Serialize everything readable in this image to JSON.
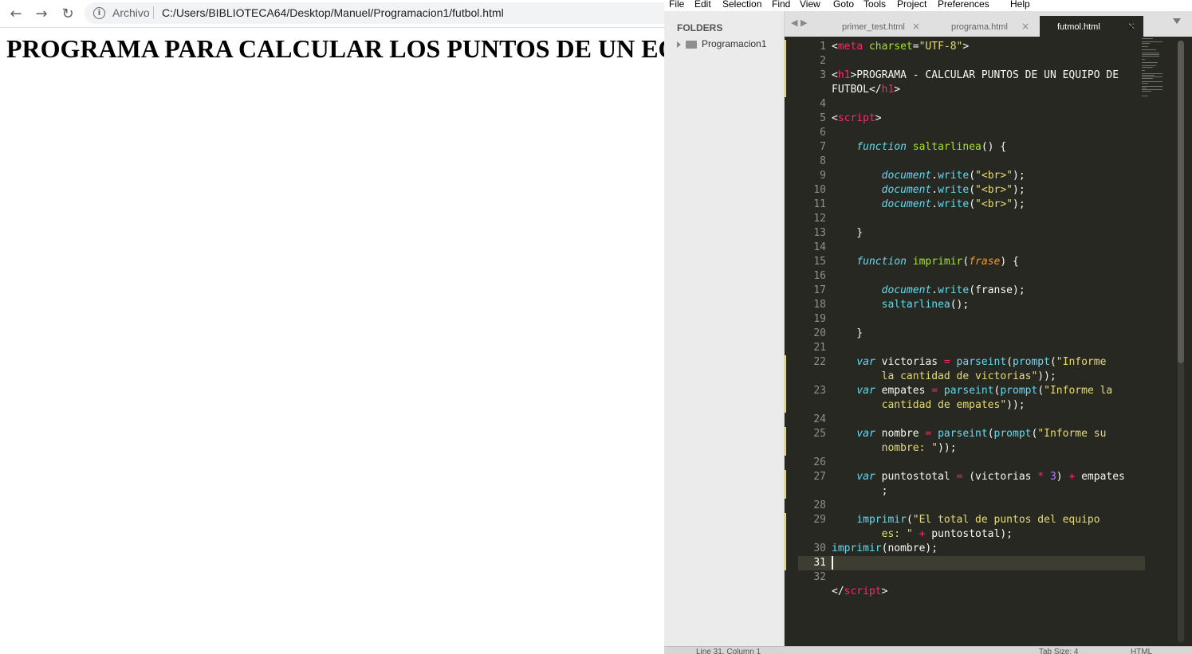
{
  "browser": {
    "nav": {
      "back_icon": "←",
      "forward_icon": "→",
      "reload_icon": "↻"
    },
    "omnibox": {
      "protocol_label": "Archivo",
      "url": "C:/Users/BIBLIOTECA64/Desktop/Manuel/Programacion1/futbol.html"
    },
    "page": {
      "heading": "PROGRAMA PARA CALCULAR LOS PUNTOS DE UN EQUIPO DE FUTBOL"
    }
  },
  "editor": {
    "menu": [
      "File",
      "Edit",
      "Selection",
      "Find",
      "View",
      "Goto",
      "Tools",
      "Project",
      "Preferences",
      "Help"
    ],
    "sidebar": {
      "title": "FOLDERS",
      "folder": "Programacion1"
    },
    "tabs": [
      {
        "label": "primer_test.html",
        "active": false
      },
      {
        "label": "programa.html",
        "active": false
      },
      {
        "label": "futmol.html",
        "active": true
      }
    ],
    "tab_close_icon": "×",
    "line_numbers": [
      "1",
      "2",
      "3",
      "4",
      "5",
      "6",
      "7",
      "8",
      "9",
      "10",
      "11",
      "12",
      "13",
      "14",
      "15",
      "16",
      "17",
      "18",
      "19",
      "20",
      "21",
      "22",
      "23",
      "24",
      "25",
      "26",
      "27",
      "28",
      "29",
      "30",
      "31",
      "32"
    ],
    "code": [
      [
        [
          "t-p",
          "<"
        ],
        [
          "t-t",
          "meta"
        ],
        [
          "t-p",
          " "
        ],
        [
          "t-a",
          "charset"
        ],
        [
          "t-p",
          "="
        ],
        [
          "t-s",
          "\"UTF-8\""
        ],
        [
          "t-p",
          ">"
        ]
      ],
      [],
      [
        [
          "t-p",
          "<"
        ],
        [
          "t-t",
          "h1"
        ],
        [
          "t-p",
          ">PROGRAMA - CALCULAR PUNTOS DE UN EQUIPO DE"
        ]
      ],
      [
        [
          "t-p",
          "FUTBOL</"
        ],
        [
          "t-t",
          "h1"
        ],
        [
          "t-p",
          ">"
        ]
      ],
      [],
      [
        [
          "t-p",
          "<"
        ],
        [
          "t-t",
          "script"
        ],
        [
          "t-p",
          ">"
        ]
      ],
      [],
      [
        [
          "t-p",
          "    "
        ],
        [
          "t-k",
          "function"
        ],
        [
          "t-p",
          " "
        ],
        [
          "t-f",
          "saltarlinea"
        ],
        [
          "t-p",
          "() {"
        ]
      ],
      [],
      [
        [
          "t-p",
          "        "
        ],
        [
          "t-k",
          "document"
        ],
        [
          "t-p",
          "."
        ],
        [
          "t-c",
          "write"
        ],
        [
          "t-p",
          "("
        ],
        [
          "t-s",
          "\"<br>\""
        ],
        [
          "t-p",
          ");"
        ]
      ],
      [
        [
          "t-p",
          "        "
        ],
        [
          "t-k",
          "document"
        ],
        [
          "t-p",
          "."
        ],
        [
          "t-c",
          "write"
        ],
        [
          "t-p",
          "("
        ],
        [
          "t-s",
          "\"<br>\""
        ],
        [
          "t-p",
          ");"
        ]
      ],
      [
        [
          "t-p",
          "        "
        ],
        [
          "t-k",
          "document"
        ],
        [
          "t-p",
          "."
        ],
        [
          "t-c",
          "write"
        ],
        [
          "t-p",
          "("
        ],
        [
          "t-s",
          "\"<br>\""
        ],
        [
          "t-p",
          ");"
        ]
      ],
      [],
      [
        [
          "t-p",
          "    }"
        ]
      ],
      [],
      [
        [
          "t-p",
          "    "
        ],
        [
          "t-k",
          "function"
        ],
        [
          "t-p",
          " "
        ],
        [
          "t-f",
          "imprimir"
        ],
        [
          "t-p",
          "("
        ],
        [
          "t-par",
          "frase"
        ],
        [
          "t-p",
          ") {"
        ]
      ],
      [],
      [
        [
          "t-p",
          "        "
        ],
        [
          "t-k",
          "document"
        ],
        [
          "t-p",
          "."
        ],
        [
          "t-c",
          "write"
        ],
        [
          "t-p",
          "(franse);"
        ]
      ],
      [
        [
          "t-p",
          "        "
        ],
        [
          "t-c",
          "saltarlinea"
        ],
        [
          "t-p",
          "();"
        ]
      ],
      [],
      [
        [
          "t-p",
          "    }"
        ]
      ],
      [],
      [
        [
          "t-p",
          "    "
        ],
        [
          "t-k",
          "var"
        ],
        [
          "t-p",
          " victorias "
        ],
        [
          "t-o",
          "="
        ],
        [
          "t-p",
          " "
        ],
        [
          "t-c",
          "parseint"
        ],
        [
          "t-p",
          "("
        ],
        [
          "t-c",
          "prompt"
        ],
        [
          "t-p",
          "("
        ],
        [
          "t-s",
          "\"Informe"
        ]
      ],
      [
        [
          "t-s",
          "        la cantidad de victorias\""
        ],
        [
          "t-p",
          "));"
        ]
      ],
      [
        [
          "t-p",
          "    "
        ],
        [
          "t-k",
          "var"
        ],
        [
          "t-p",
          " empates "
        ],
        [
          "t-o",
          "="
        ],
        [
          "t-p",
          " "
        ],
        [
          "t-c",
          "parseint"
        ],
        [
          "t-p",
          "("
        ],
        [
          "t-c",
          "prompt"
        ],
        [
          "t-p",
          "("
        ],
        [
          "t-s",
          "\"Informe la"
        ]
      ],
      [
        [
          "t-s",
          "        cantidad de empates\""
        ],
        [
          "t-p",
          "));"
        ]
      ],
      [],
      [
        [
          "t-p",
          "    "
        ],
        [
          "t-k",
          "var"
        ],
        [
          "t-p",
          " nombre "
        ],
        [
          "t-o",
          "="
        ],
        [
          "t-p",
          " "
        ],
        [
          "t-c",
          "parseint"
        ],
        [
          "t-p",
          "("
        ],
        [
          "t-c",
          "prompt"
        ],
        [
          "t-p",
          "("
        ],
        [
          "t-s",
          "\"Informe su"
        ]
      ],
      [
        [
          "t-s",
          "        nombre: \""
        ],
        [
          "t-p",
          "));"
        ]
      ],
      [],
      [
        [
          "t-p",
          "    "
        ],
        [
          "t-k",
          "var"
        ],
        [
          "t-p",
          " puntostotal "
        ],
        [
          "t-o",
          "="
        ],
        [
          "t-p",
          " (victorias "
        ],
        [
          "t-o",
          "*"
        ],
        [
          "t-p",
          " "
        ],
        [
          "t-n",
          "3"
        ],
        [
          "t-p",
          ") "
        ],
        [
          "t-o",
          "+"
        ],
        [
          "t-p",
          " empates"
        ]
      ],
      [
        [
          "t-p",
          "        ;"
        ]
      ],
      [],
      [
        [
          "t-p",
          "    "
        ],
        [
          "t-c",
          "imprimir"
        ],
        [
          "t-p",
          "("
        ],
        [
          "t-s",
          "\"El total de puntos del equipo"
        ]
      ],
      [
        [
          "t-s",
          "        es: \""
        ],
        [
          "t-p",
          " "
        ],
        [
          "t-o",
          "+"
        ],
        [
          "t-p",
          " puntostotal);"
        ]
      ],
      [
        [
          "t-c",
          "imprimir"
        ],
        [
          "t-p",
          "(nombre);"
        ]
      ],
      [],
      [],
      [
        [
          "t-p",
          "</"
        ],
        [
          "t-t",
          "script"
        ],
        [
          "t-p",
          ">"
        ]
      ]
    ],
    "status": {
      "position": "Line 31, Column 1",
      "tab_size": "Tab Size: 4",
      "syntax": "HTML"
    }
  }
}
